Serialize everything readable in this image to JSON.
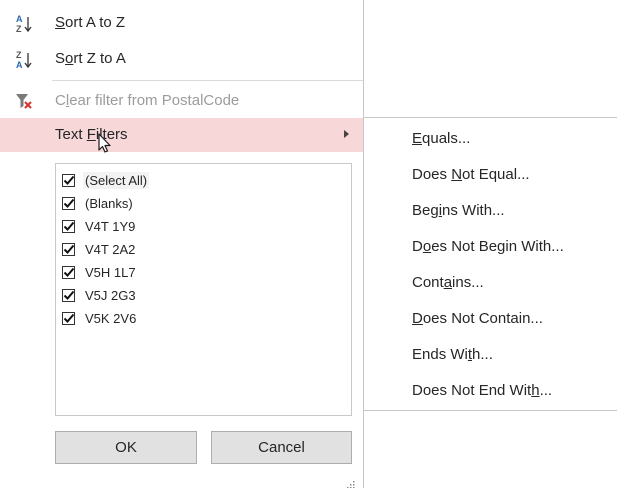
{
  "menu": {
    "sort_asc": {
      "before": "",
      "key": "S",
      "after": "ort A to Z"
    },
    "sort_desc": {
      "before": "S",
      "key": "o",
      "after": "rt Z to A"
    },
    "clear_filter": {
      "before": "C",
      "key": "l",
      "after": "ear filter from PostalCode"
    },
    "text_filters": {
      "before": "Text ",
      "key": "F",
      "after": "ilters"
    },
    "icons": {
      "sort_asc": "sort-a-to-z-icon",
      "sort_desc": "sort-z-to-a-icon",
      "clear_filter": "clear-filter-icon",
      "submenu": "chevron-right-icon",
      "cursor": "mouse-pointer-icon"
    }
  },
  "values_list": {
    "items": [
      {
        "label": "(Select All)",
        "checked": true
      },
      {
        "label": "(Blanks)",
        "checked": true
      },
      {
        "label": "V4T 1Y9",
        "checked": true
      },
      {
        "label": "V4T 2A2",
        "checked": true
      },
      {
        "label": "V5H 1L7",
        "checked": true
      },
      {
        "label": "V5J 2G3",
        "checked": true
      },
      {
        "label": "V5K 2V6",
        "checked": true
      }
    ]
  },
  "buttons": {
    "ok": "OK",
    "cancel": "Cancel"
  },
  "submenu": {
    "items": [
      {
        "before": "",
        "key": "E",
        "after": "quals..."
      },
      {
        "before": "Does ",
        "key": "N",
        "after": "ot Equal..."
      },
      {
        "before": "Beg",
        "key": "i",
        "after": "ns With..."
      },
      {
        "before": "D",
        "key": "o",
        "after": "es Not Begin With..."
      },
      {
        "before": "Cont",
        "key": "a",
        "after": "ins..."
      },
      {
        "before": "",
        "key": "D",
        "after": "oes Not Contain..."
      },
      {
        "before": "Ends Wi",
        "key": "t",
        "after": "h..."
      },
      {
        "before": "Does Not End Wit",
        "key": "h",
        "after": "..."
      }
    ]
  },
  "colors": {
    "active_highlight": "#f7d7d7",
    "clear_filter_red": "#d9342b"
  }
}
